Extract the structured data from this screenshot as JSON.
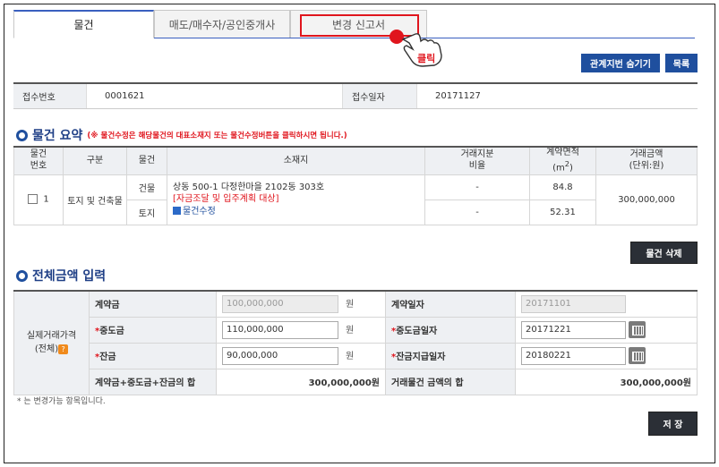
{
  "tabs": [
    {
      "label": "물건"
    },
    {
      "label": "매도/매수자/공인중개사"
    },
    {
      "label": "변경 신고서"
    }
  ],
  "click_label": "클릭",
  "buttons": {
    "hide_share": "관계지번 숨기기",
    "list": "목록",
    "delete_item": "물건 삭제",
    "save": "저 장"
  },
  "receipt": {
    "num_label": "접수번호",
    "num_value": "0001621",
    "date_label": "접수일자",
    "date_value": "20171127"
  },
  "summary": {
    "title": "물건 요약",
    "note": "(※ 물건수정은 해당물건의 대표소재지 또는 물건수정버튼을 클릭하시면 됩니다.)",
    "headers": {
      "no": "물건\n번호",
      "type": "구분",
      "item": "물건",
      "addr": "소재지",
      "share": "거래지분\n비율",
      "area": "계약면적",
      "area_unit": "(m",
      "area_sup": "2",
      "area_close": ")",
      "price": "거래금액",
      "price_unit": "(단위:원)"
    },
    "row": {
      "no": "1",
      "type": "토지 및 건축물",
      "item1": "건물",
      "item2": "토지",
      "addr": "상동 500-1 다정한마을 2102동 303호",
      "addr_note": "[자금조달 및 입주계획 대상]",
      "edit": "물건수정",
      "share1": "-",
      "share2": "-",
      "area1": "84.8",
      "area2": "52.31",
      "price": "300,000,000"
    }
  },
  "total": {
    "title": "전체금액 입력",
    "side_label1": "실제거래가격",
    "side_label2": "(전체)",
    "q_icon": "?",
    "deposit_label": "계약금",
    "deposit_value": "100,000,000",
    "deposit_unit": "원",
    "contract_date_label": "계약일자",
    "contract_date_value": "20171101",
    "middle_label": "중도금",
    "middle_value": "110,000,000",
    "middle_unit": "원",
    "middle_date_label": "중도금일자",
    "middle_date_value": "20171221",
    "balance_label": "잔금",
    "balance_value": "90,000,000",
    "balance_unit": "원",
    "balance_date_label": "잔금지급일자",
    "balance_date_value": "20180221",
    "sum_label": "계약금+중도금+잔금의 합",
    "sum_value": "300,000,000원",
    "deal_sum_label": "거래물건 금액의 합",
    "deal_sum_value": "300,000,000원",
    "star": "*"
  },
  "footnote": "* 는 변경가능 항목입니다."
}
